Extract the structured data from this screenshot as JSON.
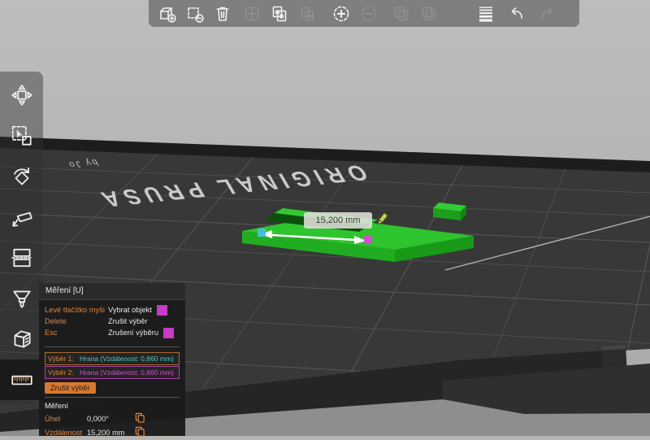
{
  "scene": {
    "bed_text": "ORIGINAL PRUSA",
    "bed_text_small": "by Jo",
    "measurement_label": "15,200 mm",
    "colors": {
      "sky": "#b6b6b4",
      "plate": "#383838",
      "object_green": "#2dc42d",
      "marker_start_cyan": "#45bfd8",
      "marker_end_magenta": "#d04fd0",
      "accent_orange": "#dd8640"
    }
  },
  "top_toolbar": {
    "items": [
      {
        "name": "add-object",
        "enabled": true
      },
      {
        "name": "delete-object",
        "enabled": true
      },
      {
        "name": "delete-all",
        "enabled": true
      },
      {
        "name": "arrange",
        "enabled": false
      },
      {
        "name": "copy",
        "enabled": true
      },
      {
        "name": "paste",
        "enabled": false
      },
      {
        "name": "add-instance",
        "enabled": true
      },
      {
        "name": "remove-instance",
        "enabled": false
      },
      {
        "name": "split-to-objects",
        "enabled": false
      },
      {
        "name": "split-to-parts",
        "enabled": false
      },
      {
        "name": "variable-layer-height",
        "enabled": true
      },
      {
        "name": "undo",
        "enabled": true
      },
      {
        "name": "redo",
        "enabled": false
      }
    ]
  },
  "left_toolbar": {
    "active": "measure",
    "items": [
      {
        "name": "move"
      },
      {
        "name": "scale"
      },
      {
        "name": "rotate"
      },
      {
        "name": "place-on-face"
      },
      {
        "name": "cut"
      },
      {
        "name": "paint-supports"
      },
      {
        "name": "seam"
      },
      {
        "name": "measure"
      }
    ]
  },
  "measure_panel": {
    "title": "Měření [U]",
    "hints": [
      {
        "key": "Levé tlačítko myši",
        "action": "Vybrat objekt",
        "swatch": "#c73bc7"
      },
      {
        "key": "Delete",
        "action": "Zrušit výběr",
        "swatch": null
      },
      {
        "key": "Esc",
        "action": "Zrušení výběru",
        "swatch": "#c73bc7"
      }
    ],
    "selections": [
      {
        "label": "Výběr 1:",
        "value": "Hrana (Vzdálenost: 0,860 mm)"
      },
      {
        "label": "Výběr 2:",
        "value": "Hrana (Vzdálenost: 0,860 mm)"
      }
    ],
    "reset_button": "Zrušit výběr",
    "section_title": "Měření",
    "results": [
      {
        "label": "Úhel",
        "value": "0,000°"
      },
      {
        "label": "Vzdálenost",
        "value": "15,200 mm"
      }
    ]
  }
}
